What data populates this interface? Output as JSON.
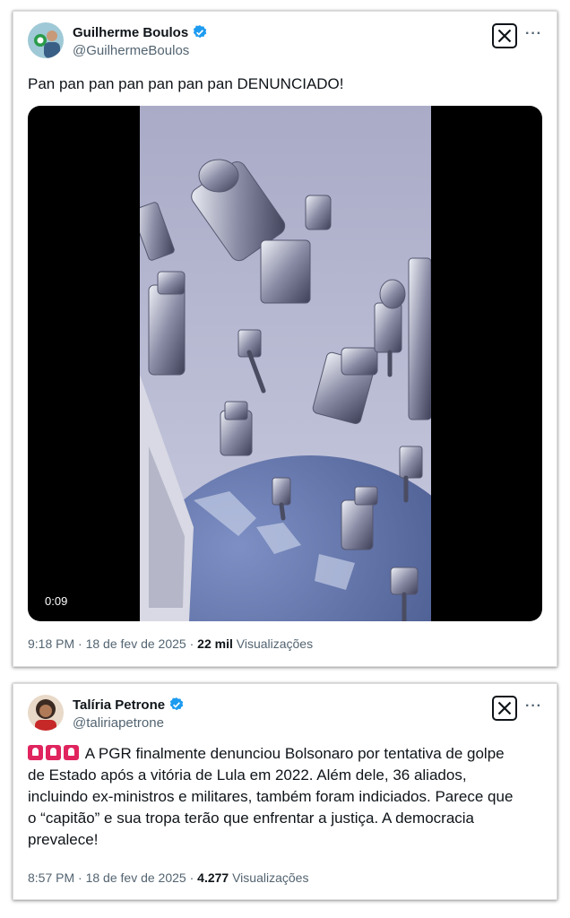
{
  "tweets": [
    {
      "author_name": "Guilherme Boulos",
      "author_handle": "@GuilhermeBoulos",
      "text": "Pan pan pan pan pan pan pan DENUNCIADO!",
      "media": {
        "type": "video",
        "duration": "0:09"
      },
      "time": "9:18 PM",
      "date": "18 de fev de 2025",
      "views_count": "22 mil",
      "views_label": "Visualizações"
    },
    {
      "author_name": "Talíria Petrone",
      "author_handle": "@taliriapetrone",
      "emoji_prefix": [
        "police-light-icon",
        "police-light-icon",
        "police-light-icon"
      ],
      "text_lines": [
        "A PGR finalmente denunciou Bolsonaro por tentativa de golpe",
        "de Estado após a vitória de Lula em 2022. Além dele, 36 aliados,",
        "incluindo ex-ministros e militares, também foram indiciados. Parece que",
        "o “capitão” e sua tropa terão que enfrentar a justiça. A democracia",
        "prevalece!"
      ],
      "time": "8:57 PM",
      "date": "18 de fev de 2025",
      "views_count": "4.277",
      "views_label": "Visualizações"
    }
  ],
  "icons": {
    "verified": "verified-badge-icon",
    "logo": "x-logo-icon",
    "more": "more-icon"
  },
  "colors": {
    "verified": "#1d9bf0",
    "text": "#0f1419",
    "secondary": "#536471",
    "emoji": "#e0245e"
  }
}
